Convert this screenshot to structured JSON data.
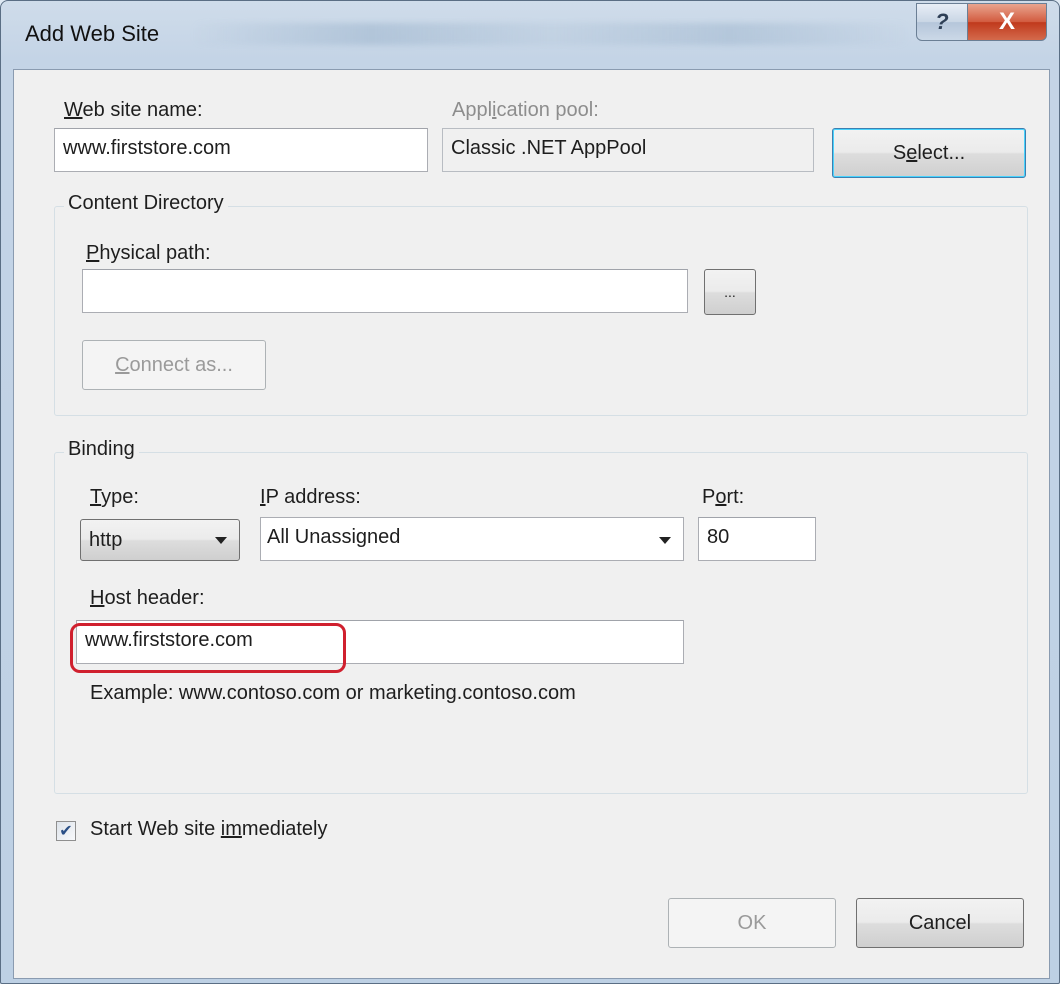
{
  "window": {
    "title": "Add Web Site",
    "help_glyph": "?",
    "close_glyph": "X"
  },
  "site_name": {
    "label_pre": "",
    "label_u": "W",
    "label_post": "eb site name:",
    "value": "www.firststore.com"
  },
  "app_pool": {
    "label_pre": "Appl",
    "label_u": "i",
    "label_post": "cation pool:",
    "value": "Classic .NET AppPool",
    "select_pre": "S",
    "select_u": "e",
    "select_post": "lect..."
  },
  "content_directory": {
    "title": "Content Directory",
    "physical_path_pre": "",
    "physical_path_u": "P",
    "physical_path_post": "hysical path:",
    "physical_path_value": "",
    "browse_label": "...",
    "connect_pre": "",
    "connect_u": "C",
    "connect_post": "onnect as..."
  },
  "binding": {
    "title": "Binding",
    "type_pre": "",
    "type_u": "T",
    "type_post": "ype:",
    "type_value": "http",
    "ip_pre": "",
    "ip_u": "I",
    "ip_post": "P address:",
    "ip_value": "All Unassigned",
    "port_pre": "P",
    "port_u": "o",
    "port_post": "rt:",
    "port_value": "80",
    "host_pre": "",
    "host_u": "H",
    "host_post": "ost header:",
    "host_value": "www.firststore.com",
    "example": "Example: www.contoso.com or marketing.contoso.com"
  },
  "start_immediately": {
    "checked": true,
    "check_glyph": "✔",
    "label_pre": "Start Web site ",
    "label_u": "im",
    "label_post": "mediately"
  },
  "footer": {
    "ok_label": "OK",
    "cancel_label": "Cancel"
  },
  "colors": {
    "highlight": "#d0202e",
    "default_button_border": "#3c7fb1"
  }
}
